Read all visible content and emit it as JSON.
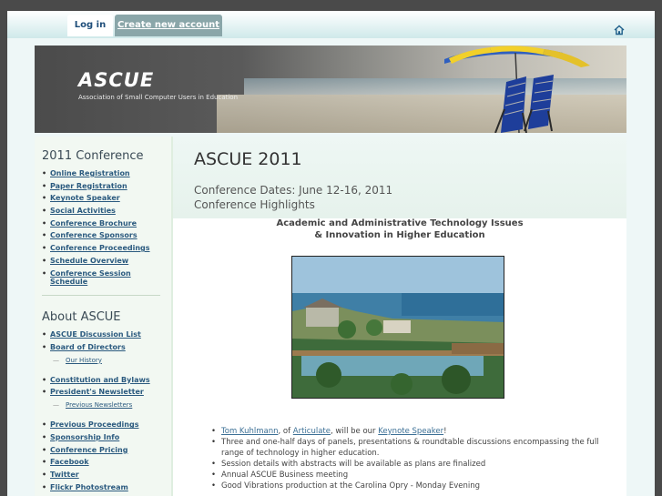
{
  "topbar": {
    "login_label": "Log in",
    "create_account_label": "Create new account",
    "home_icon": "home-icon"
  },
  "banner": {
    "title": "ASCUE",
    "subtitle": "Association of Small Computer Users in Education"
  },
  "sidebar": {
    "conference": {
      "heading": "2011 Conference",
      "items": [
        {
          "label": "Online Registration"
        },
        {
          "label": "Paper Registration"
        },
        {
          "label": "Keynote Speaker"
        },
        {
          "label": "Social Activities"
        },
        {
          "label": "Conference Brochure"
        },
        {
          "label": "Conference Sponsors"
        },
        {
          "label": "Conference Proceedings"
        },
        {
          "label": "Schedule Overview"
        },
        {
          "label": "Conference Session Schedule"
        }
      ]
    },
    "about": {
      "heading": "About ASCUE",
      "items": [
        {
          "label": "ASCUE Discussion List"
        },
        {
          "label": "Board of Directors"
        },
        {
          "label": "Our History",
          "sub": true
        },
        {
          "label": "Constitution and Bylaws"
        },
        {
          "label": "President's Newsletter"
        },
        {
          "label": "Previous Newsletters",
          "sub": true
        },
        {
          "label": "Previous Proceedings"
        },
        {
          "label": "Sponsorship Info"
        },
        {
          "label": "Conference Pricing"
        },
        {
          "label": "Facebook"
        },
        {
          "label": "Twitter"
        },
        {
          "label": "Flickr Photostream"
        }
      ]
    }
  },
  "main": {
    "title": "ASCUE 2011",
    "conference_dates": "Conference Dates: June 12-16, 2011",
    "conference_highlights": "Conference Highlights",
    "tagline_line1": "Academic and Administrative Technology Issues",
    "tagline_line2": "& Innovation in Higher Education",
    "highlights": {
      "keynote": {
        "name": "Tom Kuhlmann",
        "of": ", of ",
        "company": "Articulate",
        "middle": ", will be our ",
        "role": "Keynote Speaker",
        "end": "!"
      },
      "items": [
        "Three and one-half days of panels, presentations & roundtable discussions encompassing the full range of technology in higher education.",
        "Session details with abstracts will be available as plans are finalized",
        "Annual ASCUE Business meeting",
        "Good Vibrations production at the Carolina Opry - Monday Evening"
      ]
    }
  }
}
